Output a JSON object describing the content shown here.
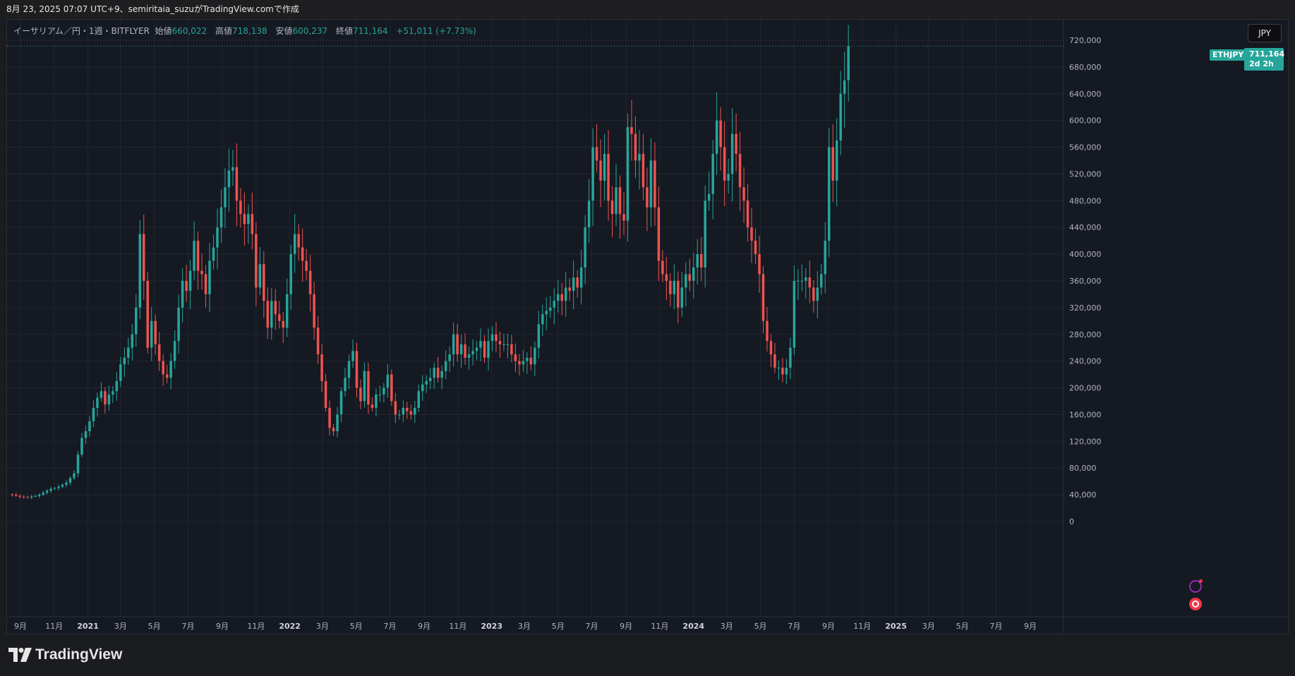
{
  "header": {
    "caption": "8月 23, 2025 07:07 UTC+9、semiritaia_suzuがTradingView.comで作成"
  },
  "legend": {
    "symbol": "イーサリアム／円・1週・BITFLYER",
    "open_label": "始値",
    "open": "660,022",
    "high_label": "高値",
    "high": "718,138",
    "low_label": "安値",
    "low": "600,237",
    "close_label": "終値",
    "close": "711,164",
    "change": "+51,011 (+7.73%)"
  },
  "price_axis": {
    "currency": "JPY",
    "symbol_tag": "ETHJPY",
    "last_price": "711,164",
    "countdown": "2d 2h"
  },
  "branding": {
    "logo_text": "TradingView"
  },
  "colors": {
    "up": "#26a69a",
    "down": "#ef5350",
    "background": "#151922",
    "grid": "#222631"
  },
  "chart_data": {
    "type": "candlestick",
    "title": "イーサリアム／円・1週・BITFLYER",
    "ylim": [
      0,
      720000
    ],
    "y_ticks": [
      "0",
      "40,000",
      "80,000",
      "120,000",
      "160,000",
      "200,000",
      "240,000",
      "280,000",
      "320,000",
      "360,000",
      "400,000",
      "440,000",
      "480,000",
      "520,000",
      "560,000",
      "600,000",
      "640,000",
      "680,000",
      "720,000"
    ],
    "x_ticks": [
      {
        "date": "2020-09-01",
        "label": "9月",
        "bold": false
      },
      {
        "date": "2020-11-01",
        "label": "11月",
        "bold": false
      },
      {
        "date": "2021-01-01",
        "label": "2021",
        "bold": true
      },
      {
        "date": "2021-03-01",
        "label": "3月",
        "bold": false
      },
      {
        "date": "2021-05-01",
        "label": "5月",
        "bold": false
      },
      {
        "date": "2021-07-01",
        "label": "7月",
        "bold": false
      },
      {
        "date": "2021-09-01",
        "label": "9月",
        "bold": false
      },
      {
        "date": "2021-11-01",
        "label": "11月",
        "bold": false
      },
      {
        "date": "2022-01-01",
        "label": "2022",
        "bold": true
      },
      {
        "date": "2022-03-01",
        "label": "3月",
        "bold": false
      },
      {
        "date": "2022-05-01",
        "label": "5月",
        "bold": false
      },
      {
        "date": "2022-07-01",
        "label": "7月",
        "bold": false
      },
      {
        "date": "2022-09-01",
        "label": "9月",
        "bold": false
      },
      {
        "date": "2022-11-01",
        "label": "11月",
        "bold": false
      },
      {
        "date": "2023-01-01",
        "label": "2023",
        "bold": true
      },
      {
        "date": "2023-03-01",
        "label": "3月",
        "bold": false
      },
      {
        "date": "2023-05-01",
        "label": "5月",
        "bold": false
      },
      {
        "date": "2023-07-01",
        "label": "7月",
        "bold": false
      },
      {
        "date": "2023-09-01",
        "label": "9月",
        "bold": false
      },
      {
        "date": "2023-11-01",
        "label": "11月",
        "bold": false
      },
      {
        "date": "2024-01-01",
        "label": "2024",
        "bold": true
      },
      {
        "date": "2024-03-01",
        "label": "3月",
        "bold": false
      },
      {
        "date": "2024-05-01",
        "label": "5月",
        "bold": false
      },
      {
        "date": "2024-07-01",
        "label": "7月",
        "bold": false
      },
      {
        "date": "2024-09-01",
        "label": "9月",
        "bold": false
      },
      {
        "date": "2024-11-01",
        "label": "11月",
        "bold": false
      },
      {
        "date": "2025-01-01",
        "label": "2025",
        "bold": true
      },
      {
        "date": "2025-03-01",
        "label": "3月",
        "bold": false
      },
      {
        "date": "2025-05-01",
        "label": "5月",
        "bold": false
      },
      {
        "date": "2025-07-01",
        "label": "7月",
        "bold": false
      },
      {
        "date": "2025-09-01",
        "label": "9月",
        "bold": false
      }
    ],
    "first_candle_date": "2020-08-17",
    "interval": "1週",
    "closes": [
      40000,
      38500,
      37000,
      36500,
      36000,
      37500,
      38000,
      40000,
      43000,
      46000,
      49000,
      50000,
      52000,
      55000,
      58000,
      65000,
      72000,
      100000,
      125000,
      135000,
      150000,
      170000,
      185000,
      195000,
      175000,
      190000,
      195000,
      210000,
      235000,
      245000,
      260000,
      280000,
      320000,
      430000,
      360000,
      260000,
      300000,
      265000,
      240000,
      220000,
      215000,
      240000,
      270000,
      320000,
      360000,
      345000,
      375000,
      420000,
      375000,
      370000,
      340000,
      390000,
      410000,
      440000,
      470000,
      500000,
      525000,
      530000,
      480000,
      460000,
      445000,
      460000,
      430000,
      350000,
      385000,
      330000,
      290000,
      330000,
      310000,
      300000,
      290000,
      340000,
      400000,
      430000,
      410000,
      390000,
      375000,
      340000,
      290000,
      250000,
      210000,
      170000,
      140000,
      135000,
      160000,
      195000,
      215000,
      240000,
      255000,
      200000,
      180000,
      225000,
      175000,
      170000,
      190000,
      190000,
      200000,
      220000,
      180000,
      160000,
      160000,
      170000,
      165000,
      160000,
      170000,
      195000,
      205000,
      210000,
      215000,
      230000,
      215000,
      225000,
      240000,
      250000,
      280000,
      250000,
      265000,
      245000,
      250000,
      255000,
      260000,
      270000,
      245000,
      270000,
      280000,
      270000,
      265000,
      265000,
      265000,
      250000,
      240000,
      235000,
      240000,
      245000,
      235000,
      260000,
      295000,
      310000,
      315000,
      320000,
      330000,
      340000,
      330000,
      350000,
      345000,
      365000,
      350000,
      380000,
      440000,
      480000,
      560000,
      540000,
      510000,
      550000,
      480000,
      460000,
      500000,
      460000,
      450000,
      590000,
      580000,
      540000,
      550000,
      500000,
      470000,
      540000,
      470000,
      390000,
      370000,
      360000,
      340000,
      360000,
      320000,
      350000,
      370000,
      360000,
      380000,
      400000,
      380000,
      480000,
      490000,
      550000,
      600000,
      560000,
      510000,
      520000,
      580000,
      550000,
      500000,
      480000,
      440000,
      420000,
      400000,
      370000,
      300000,
      270000,
      250000,
      230000,
      230000,
      220000,
      230000,
      260000,
      360000,
      360000,
      360000,
      365000,
      350000,
      330000,
      350000,
      370000,
      420000,
      560000,
      510000,
      570000,
      640000,
      660000,
      711164
    ],
    "last_close": 711164
  }
}
